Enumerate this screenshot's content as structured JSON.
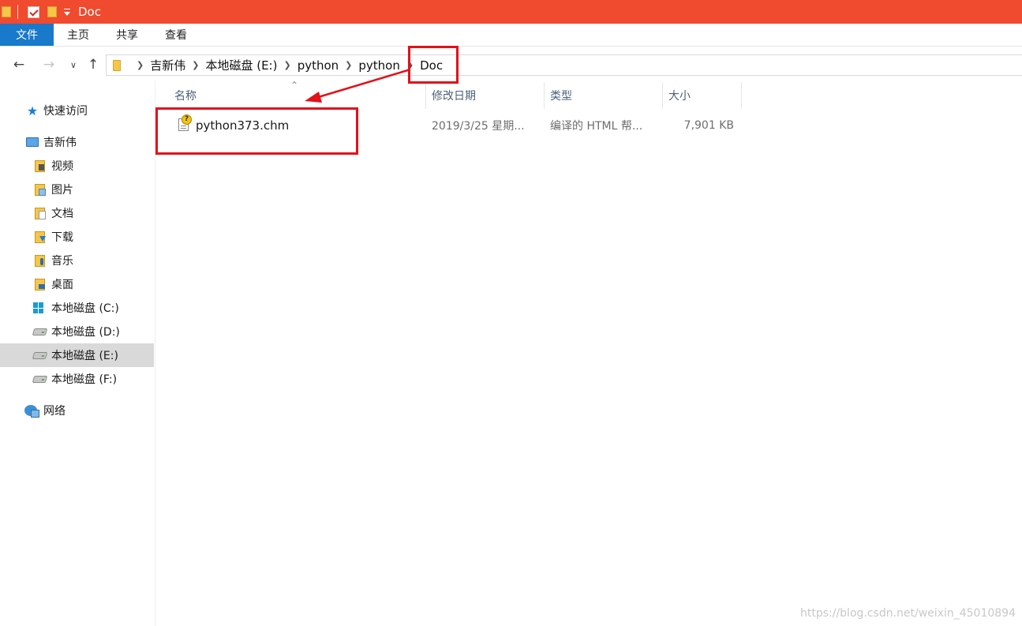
{
  "window": {
    "title": "Doc"
  },
  "ribbon": {
    "tabs": [
      "文件",
      "主页",
      "共享",
      "查看"
    ]
  },
  "breadcrumb": [
    "吉新伟",
    "本地磁盘 (E:)",
    "python",
    "python",
    "Doc"
  ],
  "sidebar": {
    "items": [
      {
        "label": "快速访问",
        "icon": "star-icon"
      },
      {
        "label": "吉新伟",
        "icon": "computer-icon"
      },
      {
        "label": "视频",
        "icon": "videos-folder-icon"
      },
      {
        "label": "图片",
        "icon": "pictures-folder-icon"
      },
      {
        "label": "文档",
        "icon": "documents-folder-icon"
      },
      {
        "label": "下载",
        "icon": "downloads-folder-icon"
      },
      {
        "label": "音乐",
        "icon": "music-folder-icon"
      },
      {
        "label": "桌面",
        "icon": "desktop-folder-icon"
      },
      {
        "label": "本地磁盘 (C:)",
        "icon": "windows-drive-icon"
      },
      {
        "label": "本地磁盘 (D:)",
        "icon": "drive-icon"
      },
      {
        "label": "本地磁盘 (E:)",
        "icon": "drive-icon",
        "selected": true
      },
      {
        "label": "本地磁盘 (F:)",
        "icon": "drive-icon"
      },
      {
        "label": "网络",
        "icon": "network-icon"
      }
    ]
  },
  "columns": {
    "name": "名称",
    "date": "修改日期",
    "type": "类型",
    "size": "大小"
  },
  "files": [
    {
      "name": "python373.chm",
      "date": "2019/3/25 星期...",
      "type": "编译的 HTML 帮...",
      "size": "7,901 KB",
      "icon": "chm-help-file-icon"
    }
  ],
  "watermark": "https://blog.csdn.net/weixin_45010894",
  "colors": {
    "titlebar": "#f04a2f",
    "file_tab": "#1979ca",
    "annotation": "#e3111a",
    "selected": "#d9d9d9"
  }
}
